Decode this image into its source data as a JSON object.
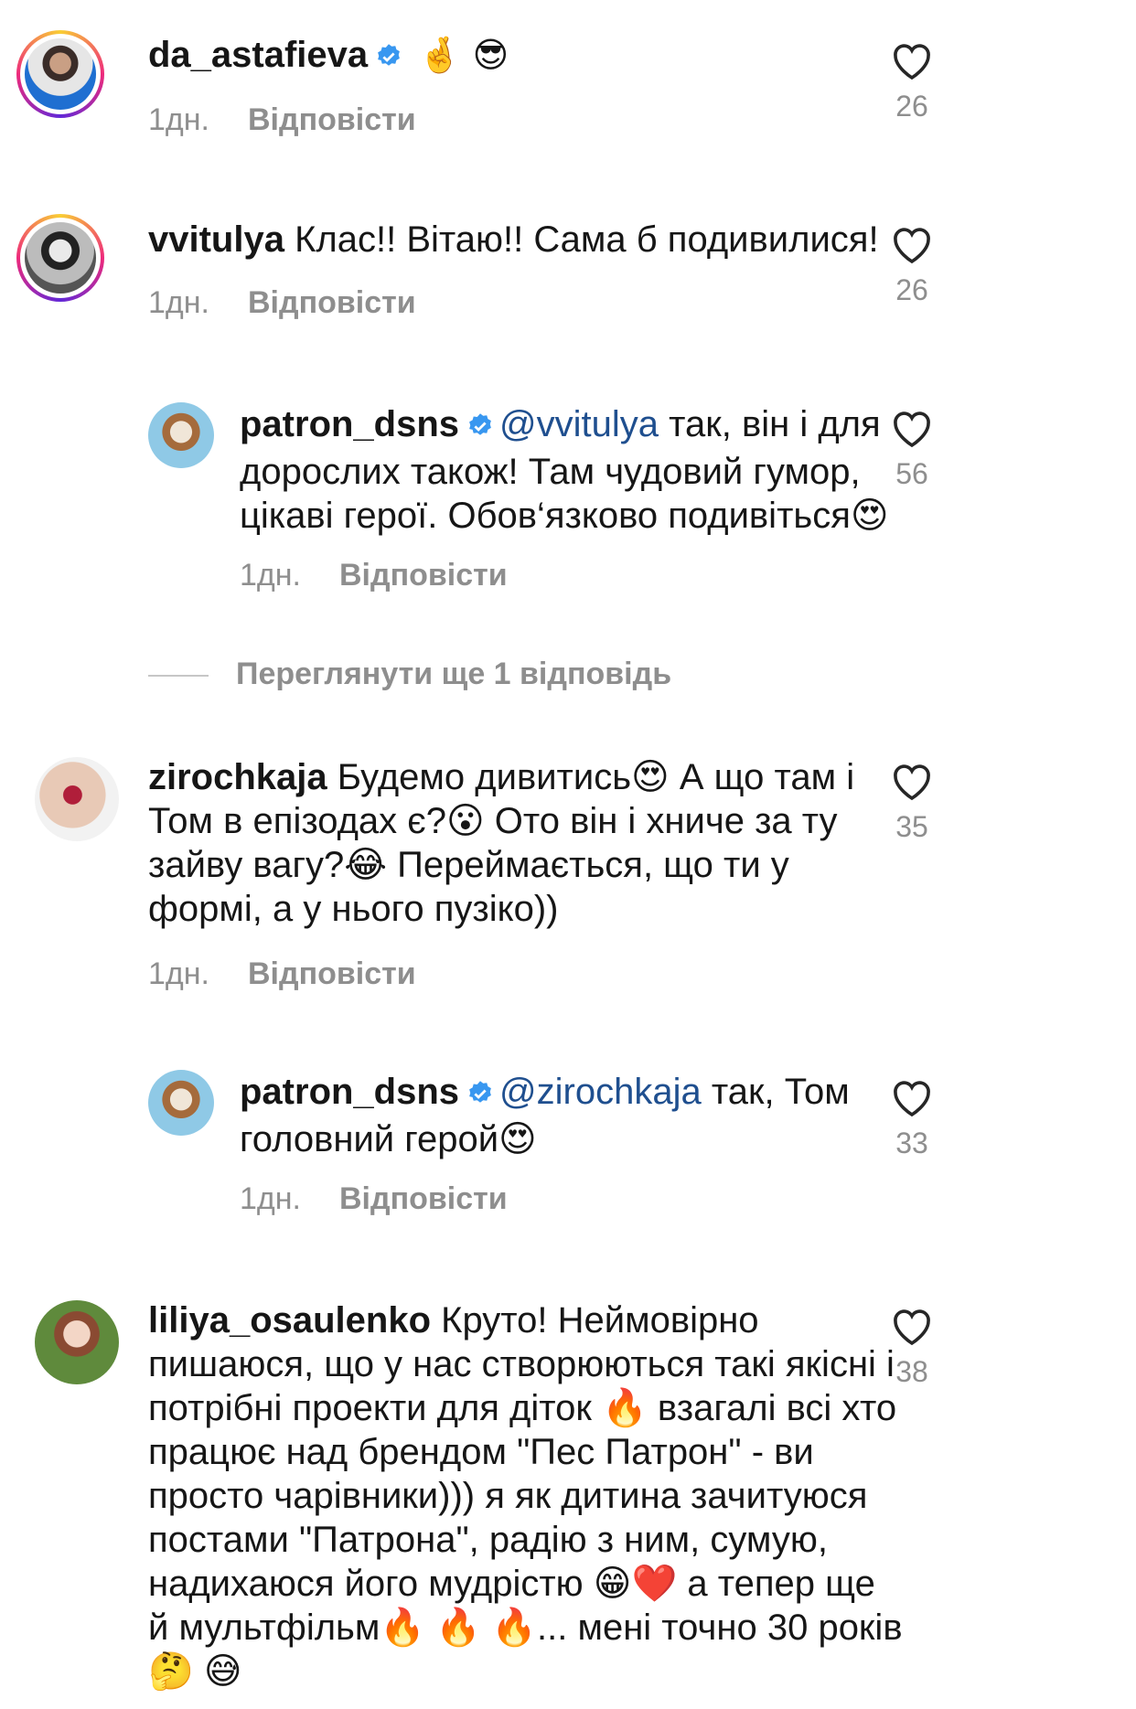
{
  "comments": [
    {
      "username": "da_astafieva",
      "verified": true,
      "text": "",
      "emoji": "🤞 😎",
      "time": "1дн.",
      "reply_label": "Відповісти",
      "likes": "26"
    },
    {
      "username": "vvitulya",
      "verified": false,
      "text": "Клас!! Вітаю!! Сама б подивилися!",
      "time": "1дн.",
      "reply_label": "Відповісти",
      "likes": "26"
    },
    {
      "username": "patron_dsns",
      "verified": true,
      "mention": "@vvitulya",
      "text_lines": [
        "так, він і для",
        "дорослих також! Там чудовий гумор,",
        "цікаві герої. Обов‘язково подивіться😍"
      ],
      "time": "1дн.",
      "reply_label": "Відповісти",
      "likes": "56"
    },
    {
      "username": "zirochkaja",
      "verified": false,
      "text_lines": [
        "Будемо дивитись😍  А що там і",
        "Том в епізодах є?😮  Ото він і хниче за ту",
        "зайву вагу?😂  Переймається, що ти у",
        "формі, а у нього пузіко))"
      ],
      "time": "1дн.",
      "reply_label": "Відповісти",
      "likes": "35"
    },
    {
      "username": "patron_dsns",
      "verified": true,
      "mention": "@zirochkaja",
      "text_lines": [
        "так, Том",
        "головний герой😍"
      ],
      "time": "1дн.",
      "reply_label": "Відповісти",
      "likes": "33"
    },
    {
      "username": "liliya_osaulenko",
      "verified": false,
      "text_lines": [
        "Круто! Неймовірно",
        "пишаюся, що у нас створюються такі якісні і",
        "потрібні проекти для діток 🔥  взагалі всі хто",
        "працює над брендом \"Пес Патрон\" - ви",
        "просто чарівники))) я як дитина зачитуюся",
        "постами \"Патрона\", радію з ним, сумую,",
        "надихаюся його мудрістю 😁❤️  а тепер ще",
        "й мультфільм🔥 🔥 🔥... мені точно 30 років",
        "🤔 😅"
      ],
      "likes": "38"
    }
  ],
  "view_more": "Переглянути ще 1 відповідь",
  "colors": {
    "verified": "#3897f0",
    "mention": "#1f4f8f",
    "meta": "#8e8e8e"
  }
}
